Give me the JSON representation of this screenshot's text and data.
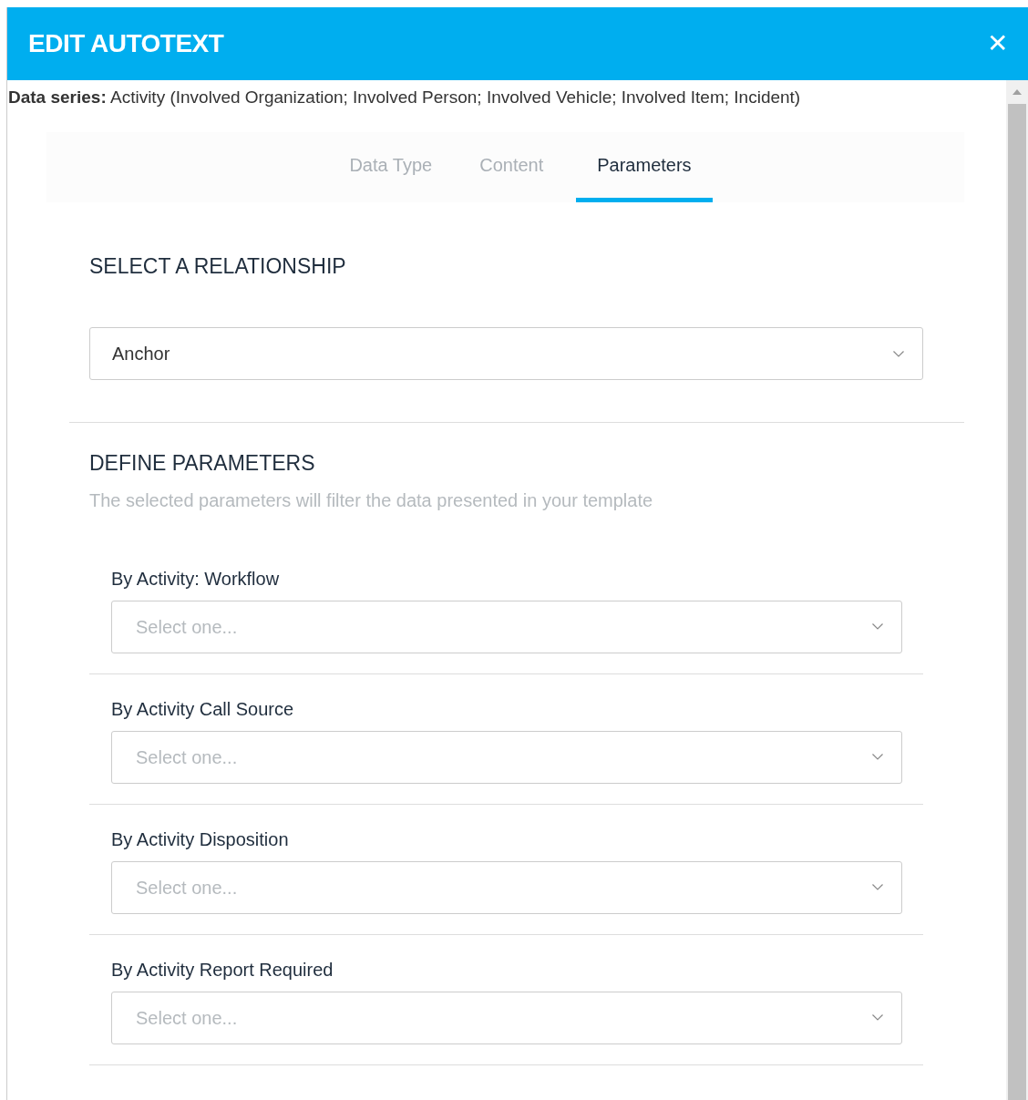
{
  "dialog": {
    "title": "EDIT AUTOTEXT",
    "close": "✕"
  },
  "data_series": "**Data series:** Activity (Involved Organization; Involved Person; Involved Vehicle; Involved Item; Incident)",
  "tabs": [
    {
      "label": "Data Type",
      "selected": false
    },
    {
      "label": "Content",
      "selected": false
    },
    {
      "label": "Parameters",
      "selected": true
    }
  ],
  "relationship": {
    "heading": "SELECT A RELATIONSHIP",
    "value": "Anchor"
  },
  "parameters": {
    "heading": "DEFINE PARAMETERS",
    "description": "The selected parameters will filter the data presented in your template",
    "items": [
      {
        "label": "By Activity: Workflow",
        "placeholder": "Select one..."
      },
      {
        "label": "By Activity Call Source",
        "placeholder": "Select one..."
      },
      {
        "label": "By Activity Disposition",
        "placeholder": "Select one..."
      },
      {
        "label": "By Activity Report Required",
        "placeholder": "Select one..."
      }
    ]
  }
}
